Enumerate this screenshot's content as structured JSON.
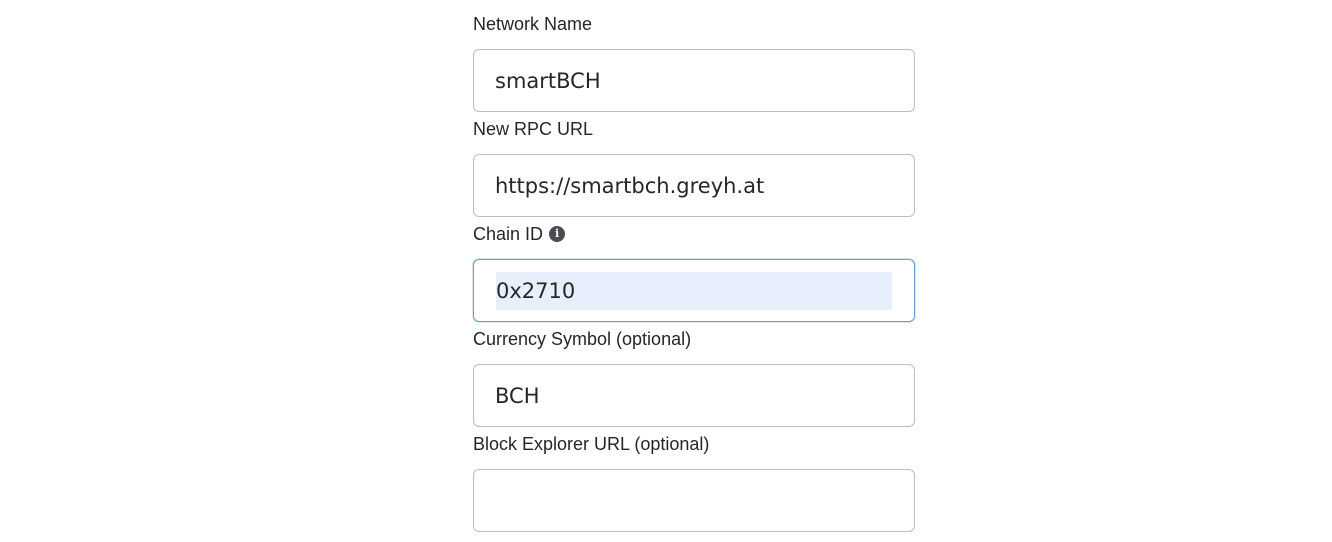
{
  "fields": [
    {
      "label": "Network Name",
      "value": "smartBCH"
    },
    {
      "label": "New RPC URL",
      "value": "https://smartbch.greyh.at"
    },
    {
      "label": "Chain ID",
      "value": "0x2710",
      "info_icon": "info-icon"
    },
    {
      "label": "Currency Symbol (optional)",
      "value": "BCH"
    },
    {
      "label": "Block Explorer URL (optional)",
      "value": ""
    }
  ],
  "colors": {
    "border": "#bbc0c5",
    "focus_border": "#6a9fc7",
    "selection": "#e8effc",
    "text": "#24272a"
  }
}
